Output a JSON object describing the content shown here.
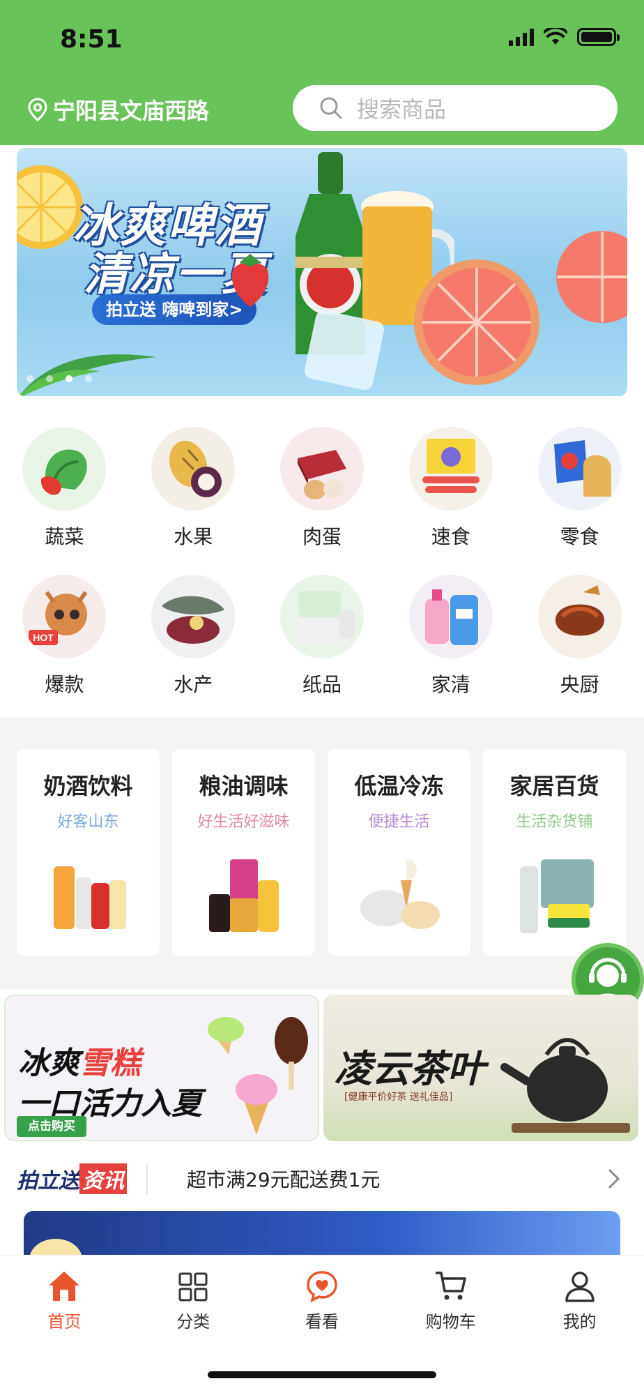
{
  "status_bar": {
    "time": "8:51"
  },
  "header": {
    "location": "宁阳县文庙西路",
    "search_placeholder": "搜索商品"
  },
  "banner": {
    "title_line1": "冰爽啤酒",
    "title_line2": "清凉一夏",
    "tag": "拍立送 嗨啤到家>",
    "page_count": 4,
    "active_index": 2
  },
  "categories": [
    {
      "label": "蔬菜",
      "icon": "vegetable-icon"
    },
    {
      "label": "水果",
      "icon": "fruit-icon"
    },
    {
      "label": "肉蛋",
      "icon": "meat-egg-icon"
    },
    {
      "label": "速食",
      "icon": "instant-food-icon"
    },
    {
      "label": "零食",
      "icon": "snack-icon"
    },
    {
      "label": "爆款",
      "icon": "hot-deer-icon"
    },
    {
      "label": "水产",
      "icon": "seafood-icon"
    },
    {
      "label": "纸品",
      "icon": "paper-icon"
    },
    {
      "label": "家清",
      "icon": "cleaning-icon"
    },
    {
      "label": "央厨",
      "icon": "central-kitchen-icon"
    }
  ],
  "sections": [
    {
      "title": "奶酒饮料",
      "subtitle": "好客山东",
      "sub_color": "#7aa7db"
    },
    {
      "title": "粮油调味",
      "subtitle": "好生活好滋味",
      "sub_color": "#e08aa0"
    },
    {
      "title": "低温冷冻",
      "subtitle": "便捷生活",
      "sub_color": "#b58ad6"
    },
    {
      "title": "家居百货",
      "subtitle": "生活杂货铺",
      "sub_color": "#8fc98a"
    }
  ],
  "promos": {
    "left_line1_a": "冰爽",
    "left_line1_b": "雪糕",
    "left_line2": "一口活力入夏",
    "left_button": "点击购买",
    "right_title": "凌云茶叶",
    "right_sub": "[健康平价好茶  送礼佳品]"
  },
  "news": {
    "logo_a": "拍立送",
    "logo_b": "资讯",
    "text": "超市满29元配送费1元"
  },
  "tabbar": {
    "tabs": [
      {
        "label": "首页",
        "icon": "home-icon",
        "active": true
      },
      {
        "label": "分类",
        "icon": "grid-icon",
        "active": false
      },
      {
        "label": "看看",
        "icon": "heart-chat-icon",
        "active": false
      },
      {
        "label": "购物车",
        "icon": "cart-icon",
        "active": false
      },
      {
        "label": "我的",
        "icon": "user-icon",
        "active": false
      }
    ]
  },
  "colors": {
    "brand_green": "#68c458",
    "accent_orange": "#e8542c",
    "service_green": "#45a640"
  }
}
